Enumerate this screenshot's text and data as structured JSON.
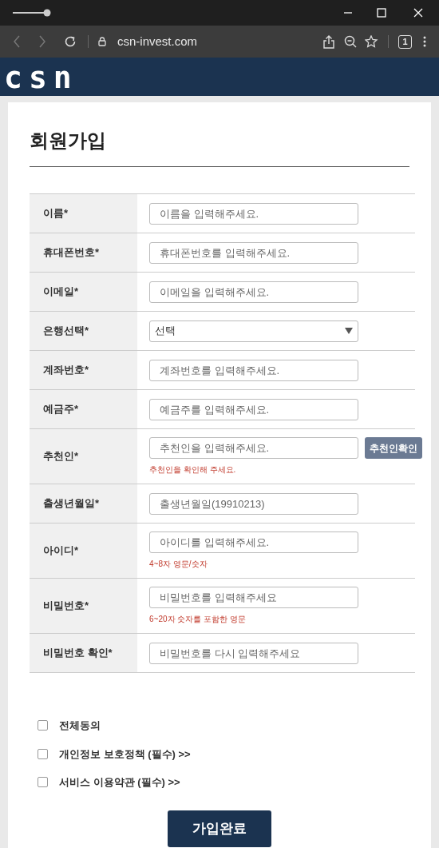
{
  "browser": {
    "url": "csn-invest.com",
    "tab_count": "1"
  },
  "site": {
    "logo": "csn"
  },
  "page": {
    "title": "회원가입"
  },
  "form": {
    "rows": [
      {
        "kind": "text",
        "label": "이름*",
        "placeholder": "이름을 입력해주세요."
      },
      {
        "kind": "text",
        "label": "휴대폰번호*",
        "placeholder": "휴대폰번호를 입력해주세요."
      },
      {
        "kind": "text",
        "label": "이메일*",
        "placeholder": "이메일을 입력해주세요."
      },
      {
        "kind": "select",
        "label": "은행선택*",
        "value": "선택"
      },
      {
        "kind": "text",
        "label": "계좌번호*",
        "placeholder": "계좌번호를 입력해주세요."
      },
      {
        "kind": "text",
        "label": "예금주*",
        "placeholder": "예금주를 입력해주세요."
      },
      {
        "kind": "text",
        "label": "추천인*",
        "placeholder": "추천인을 입력해주세요.",
        "button": "추천인확인",
        "hint": "추천인을 확인해 주세요."
      },
      {
        "kind": "text",
        "label": "출생년월일*",
        "placeholder": "출생년월일(19910213)"
      },
      {
        "kind": "text",
        "label": "아이디*",
        "placeholder": "아이디를 입력해주세요.",
        "hint": "4~8자 영문/숫자"
      },
      {
        "kind": "text",
        "label": "비밀번호*",
        "placeholder": "비밀번호를 입력해주세요",
        "hint": "6~20자 숫자를 포함한 영문"
      },
      {
        "kind": "text",
        "label": "비밀번호 확인*",
        "placeholder": "비밀번호를 다시 입력해주세요"
      }
    ]
  },
  "agreements": [
    {
      "label": "전체동의",
      "checked": false
    },
    {
      "label": "개인정보 보호정책 (필수) >>",
      "checked": false
    },
    {
      "label": "서비스 이용약관 (필수) >>",
      "checked": false
    }
  ],
  "submit": "가입완료"
}
